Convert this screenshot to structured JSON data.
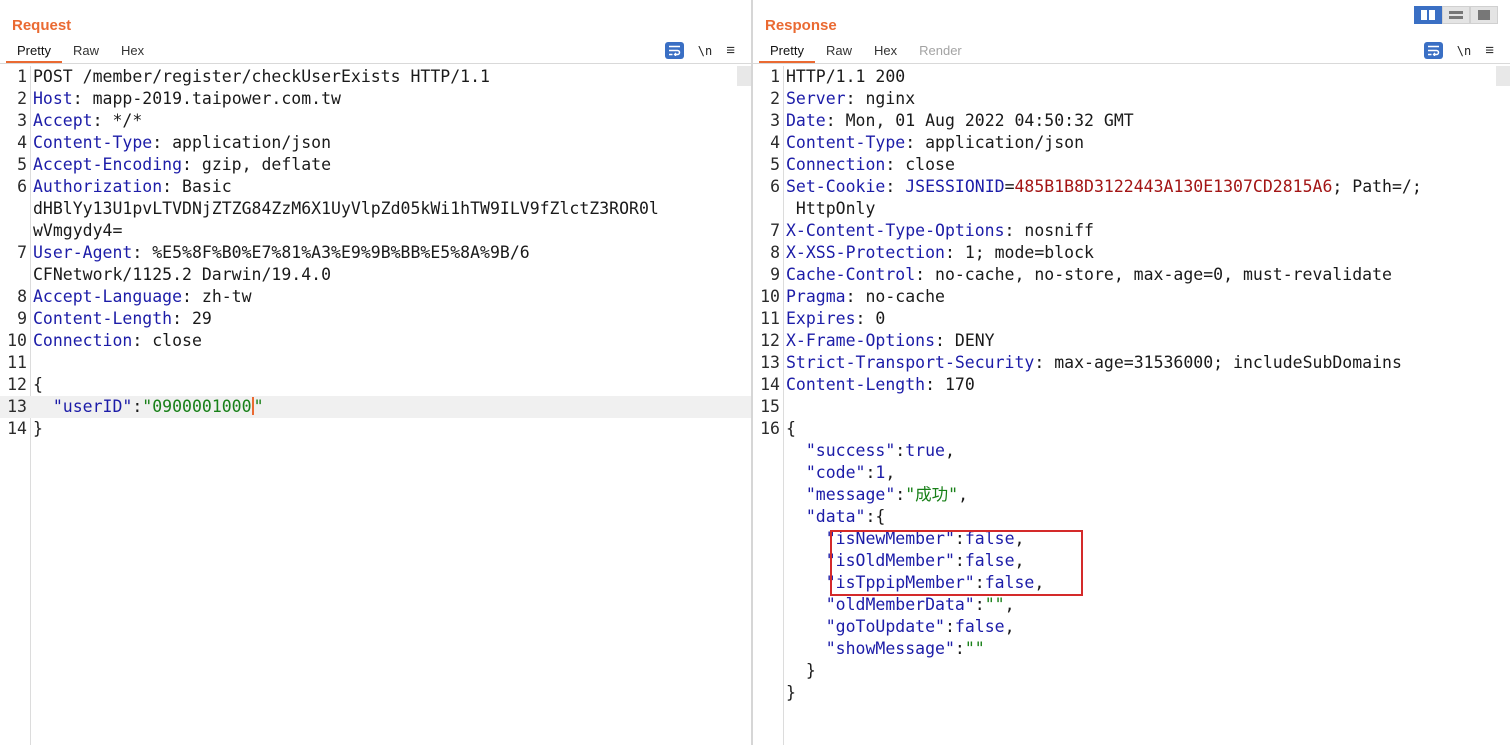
{
  "request": {
    "title": "Request",
    "tabs": [
      {
        "label": "Pretty",
        "active": true
      },
      {
        "label": "Raw"
      },
      {
        "label": "Hex"
      }
    ],
    "tools": {
      "newline_label": "\\n",
      "menu_glyph": "≡"
    },
    "lines": [
      {
        "n": "1",
        "parts": [
          {
            "t": "POST /member/register/checkUserExists HTTP/1.1"
          }
        ]
      },
      {
        "n": "2",
        "parts": [
          {
            "t": "Host",
            "c": "k"
          },
          {
            "t": ": mapp-2019.taipower.com.tw"
          }
        ]
      },
      {
        "n": "3",
        "parts": [
          {
            "t": "Accept",
            "c": "k"
          },
          {
            "t": ": */*"
          }
        ]
      },
      {
        "n": "4",
        "parts": [
          {
            "t": "Content-Type",
            "c": "k"
          },
          {
            "t": ": application/json"
          }
        ]
      },
      {
        "n": "5",
        "parts": [
          {
            "t": "Accept-Encoding",
            "c": "k"
          },
          {
            "t": ": gzip, deflate"
          }
        ]
      },
      {
        "n": "6",
        "parts": [
          {
            "t": "Authorization",
            "c": "k"
          },
          {
            "t": ": Basic"
          }
        ]
      },
      {
        "n": "",
        "parts": [
          {
            "t": "dHBlYy13U1pvLTVDNjZTZG84ZzM6X1UyVlpZd05kWi1hTW9ILV9fZlctZ3ROR0l"
          }
        ]
      },
      {
        "n": "",
        "parts": [
          {
            "t": "wVmgydy4="
          }
        ]
      },
      {
        "n": "7",
        "parts": [
          {
            "t": "User-Agent",
            "c": "k"
          },
          {
            "t": ": %E5%8F%B0%E7%81%A3%E9%9B%BB%E5%8A%9B/6"
          }
        ]
      },
      {
        "n": "",
        "parts": [
          {
            "t": "CFNetwork/1125.2 Darwin/19.4.0"
          }
        ]
      },
      {
        "n": "8",
        "parts": [
          {
            "t": "Accept-Language",
            "c": "k"
          },
          {
            "t": ": zh-tw"
          }
        ]
      },
      {
        "n": "9",
        "parts": [
          {
            "t": "Content-Length",
            "c": "k"
          },
          {
            "t": ": 29"
          }
        ]
      },
      {
        "n": "10",
        "parts": [
          {
            "t": "Connection",
            "c": "k"
          },
          {
            "t": ": close"
          }
        ]
      },
      {
        "n": "11",
        "parts": []
      },
      {
        "n": "12",
        "parts": [
          {
            "t": "{"
          }
        ]
      },
      {
        "n": "13",
        "cur": true,
        "parts": [
          {
            "t": "  \"userID\"",
            "c": "k"
          },
          {
            "t": ":"
          },
          {
            "t": "\"0900001000",
            "c": "s"
          },
          {
            "caret": true
          },
          {
            "t": "\"",
            "c": "s"
          }
        ]
      },
      {
        "n": "14",
        "parts": [
          {
            "t": "}"
          }
        ]
      }
    ]
  },
  "response": {
    "title": "Response",
    "tabs": [
      {
        "label": "Pretty",
        "active": true
      },
      {
        "label": "Raw"
      },
      {
        "label": "Hex"
      },
      {
        "label": "Render",
        "disabled": true
      }
    ],
    "tools": {
      "newline_label": "\\n",
      "menu_glyph": "≡"
    },
    "lines": [
      {
        "n": "1",
        "parts": [
          {
            "t": "HTTP/1.1 200"
          }
        ]
      },
      {
        "n": "2",
        "parts": [
          {
            "t": "Server",
            "c": "k"
          },
          {
            "t": ": nginx"
          }
        ]
      },
      {
        "n": "3",
        "parts": [
          {
            "t": "Date",
            "c": "k"
          },
          {
            "t": ": Mon, 01 Aug 2022 04:50:32 GMT"
          }
        ]
      },
      {
        "n": "4",
        "parts": [
          {
            "t": "Content-Type",
            "c": "k"
          },
          {
            "t": ": application/json"
          }
        ]
      },
      {
        "n": "5",
        "parts": [
          {
            "t": "Connection",
            "c": "k"
          },
          {
            "t": ": close"
          }
        ]
      },
      {
        "n": "6",
        "parts": [
          {
            "t": "Set-Cookie",
            "c": "k"
          },
          {
            "t": ": "
          },
          {
            "t": "JSESSIONID",
            "c": "k"
          },
          {
            "t": "="
          },
          {
            "t": "485B1B8D3122443A130E1307CD2815A6",
            "c": "r"
          },
          {
            "t": "; Path=/;"
          }
        ]
      },
      {
        "n": "",
        "parts": [
          {
            "t": " HttpOnly"
          }
        ]
      },
      {
        "n": "7",
        "parts": [
          {
            "t": "X-Content-Type-Options",
            "c": "k"
          },
          {
            "t": ": nosniff"
          }
        ]
      },
      {
        "n": "8",
        "parts": [
          {
            "t": "X-XSS-Protection",
            "c": "k"
          },
          {
            "t": ": 1; mode=block"
          }
        ]
      },
      {
        "n": "9",
        "parts": [
          {
            "t": "Cache-Control",
            "c": "k"
          },
          {
            "t": ": no-cache, no-store, max-age=0, must-revalidate"
          }
        ]
      },
      {
        "n": "10",
        "parts": [
          {
            "t": "Pragma",
            "c": "k"
          },
          {
            "t": ": no-cache"
          }
        ]
      },
      {
        "n": "11",
        "parts": [
          {
            "t": "Expires",
            "c": "k"
          },
          {
            "t": ": 0"
          }
        ]
      },
      {
        "n": "12",
        "parts": [
          {
            "t": "X-Frame-Options",
            "c": "k"
          },
          {
            "t": ": DENY"
          }
        ]
      },
      {
        "n": "13",
        "parts": [
          {
            "t": "Strict-Transport-Security",
            "c": "k"
          },
          {
            "t": ": max-age=31536000; includeSubDomains"
          }
        ]
      },
      {
        "n": "14",
        "parts": [
          {
            "t": "Content-Length",
            "c": "k"
          },
          {
            "t": ": 170"
          }
        ]
      },
      {
        "n": "15",
        "parts": []
      },
      {
        "n": "16",
        "parts": [
          {
            "t": "{"
          }
        ]
      },
      {
        "n": "",
        "parts": [
          {
            "t": "  \"success\"",
            "c": "k"
          },
          {
            "t": ":"
          },
          {
            "t": "true",
            "c": "k"
          },
          {
            "t": ","
          }
        ]
      },
      {
        "n": "",
        "parts": [
          {
            "t": "  \"code\"",
            "c": "k"
          },
          {
            "t": ":"
          },
          {
            "t": "1",
            "c": "k"
          },
          {
            "t": ","
          }
        ]
      },
      {
        "n": "",
        "parts": [
          {
            "t": "  \"message\"",
            "c": "k"
          },
          {
            "t": ":"
          },
          {
            "t": "\"成功\"",
            "c": "s"
          },
          {
            "t": ","
          }
        ]
      },
      {
        "n": "",
        "parts": [
          {
            "t": "  \"data\"",
            "c": "k"
          },
          {
            "t": ":{"
          }
        ]
      },
      {
        "n": "",
        "parts": [
          {
            "t": "    \"isNewMember\"",
            "c": "k"
          },
          {
            "t": ":"
          },
          {
            "t": "false",
            "c": "k"
          },
          {
            "t": ","
          }
        ]
      },
      {
        "n": "",
        "parts": [
          {
            "t": "    \"isOldMember\"",
            "c": "k"
          },
          {
            "t": ":"
          },
          {
            "t": "false",
            "c": "k"
          },
          {
            "t": ","
          }
        ]
      },
      {
        "n": "",
        "parts": [
          {
            "t": "    \"isTppipMember\"",
            "c": "k"
          },
          {
            "t": ":"
          },
          {
            "t": "false",
            "c": "k"
          },
          {
            "t": ","
          }
        ]
      },
      {
        "n": "",
        "parts": [
          {
            "t": "    \"oldMemberData\"",
            "c": "k"
          },
          {
            "t": ":"
          },
          {
            "t": "\"\"",
            "c": "s"
          },
          {
            "t": ","
          }
        ]
      },
      {
        "n": "",
        "parts": [
          {
            "t": "    \"goToUpdate\"",
            "c": "k"
          },
          {
            "t": ":"
          },
          {
            "t": "false",
            "c": "k"
          },
          {
            "t": ","
          }
        ]
      },
      {
        "n": "",
        "parts": [
          {
            "t": "    \"showMessage\"",
            "c": "k"
          },
          {
            "t": ":"
          },
          {
            "t": "\"\"",
            "c": "s"
          }
        ]
      },
      {
        "n": "",
        "parts": [
          {
            "t": "  }"
          }
        ]
      },
      {
        "n": "",
        "parts": [
          {
            "t": "}"
          }
        ]
      }
    ]
  },
  "colors": {
    "accent": "#ea6a32",
    "key": "#1c1ca8",
    "string": "#188018",
    "cookie_value": "#a31515",
    "highlight_box": "#d42a2a",
    "tool_blue": "#3a6fc4"
  }
}
